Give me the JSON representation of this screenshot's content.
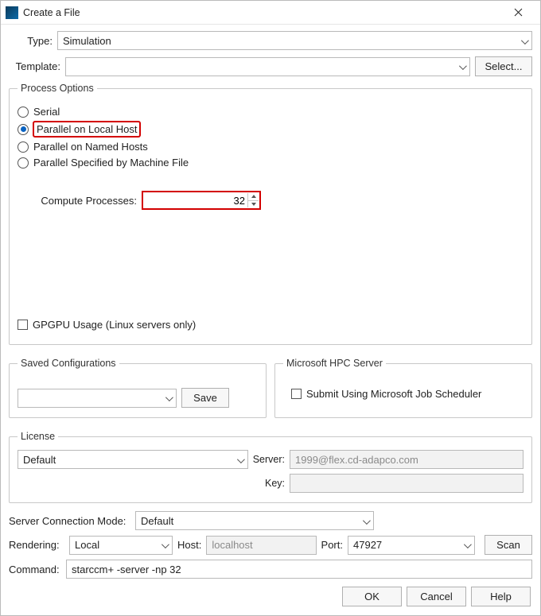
{
  "title": "Create a File",
  "type_label": "Type:",
  "type_value": "Simulation",
  "template_label": "Template:",
  "select_btn": "Select...",
  "process_options": {
    "legend": "Process Options",
    "serial": "Serial",
    "parallel_local": "Parallel on Local Host",
    "parallel_named": "Parallel on Named Hosts",
    "parallel_file": "Parallel Specified by Machine File",
    "compute_label": "Compute Processes:",
    "compute_value": "32",
    "gpgpu": "GPGPU Usage (Linux servers only)"
  },
  "saved": {
    "legend": "Saved Configurations",
    "save_btn": "Save"
  },
  "hpc": {
    "legend": "Microsoft HPC Server",
    "submit": "Submit Using Microsoft Job Scheduler"
  },
  "license": {
    "legend": "License",
    "value": "Default",
    "server_label": "Server:",
    "server_value": "1999@flex.cd-adapco.com",
    "key_label": "Key:",
    "key_value": ""
  },
  "scm": {
    "label": "Server Connection Mode:",
    "value": "Default"
  },
  "rendering": {
    "label": "Rendering:",
    "value": "Local",
    "host_label": "Host:",
    "host_value": "localhost",
    "port_label": "Port:",
    "port_value": "47927",
    "scan_btn": "Scan"
  },
  "command": {
    "label": "Command:",
    "value": "starccm+ -server -np 32"
  },
  "footer": {
    "ok": "OK",
    "cancel": "Cancel",
    "help": "Help"
  }
}
